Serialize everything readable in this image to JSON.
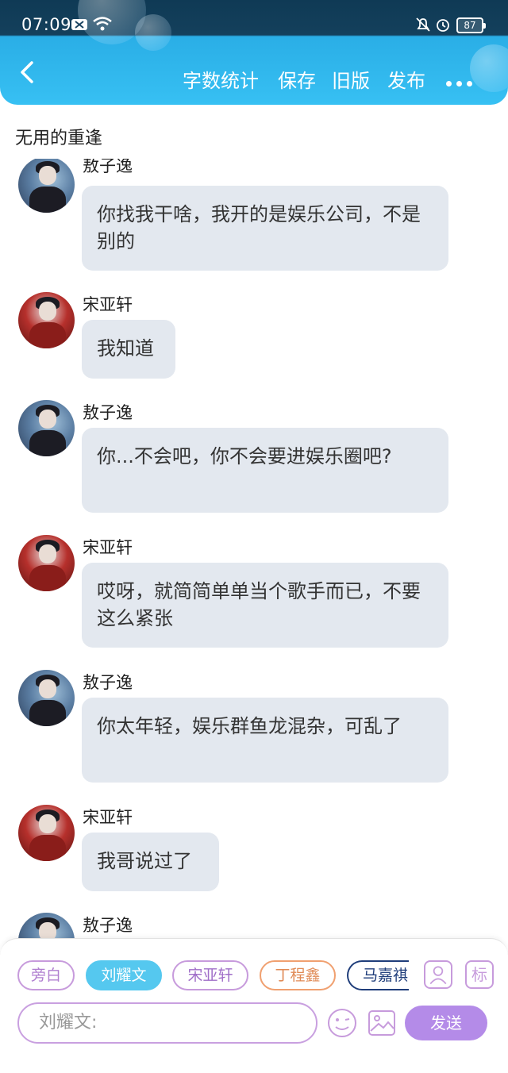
{
  "status": {
    "time": "07:09",
    "battery": "87"
  },
  "toolbar": {
    "word_count": "字数统计",
    "save": "保存",
    "old_version": "旧版",
    "publish": "发布"
  },
  "document": {
    "title": "无用的重逢"
  },
  "messages": [
    {
      "speaker": "敖子逸",
      "text": "你找我干啥，我开的是娱乐公司，不是别的",
      "avatar": "blue"
    },
    {
      "speaker": "宋亚轩",
      "text": "我知道",
      "avatar": "red"
    },
    {
      "speaker": "敖子逸",
      "text": "你...不会吧，你不会要进娱乐圈吧?",
      "avatar": "blue"
    },
    {
      "speaker": "宋亚轩",
      "text": "哎呀，就简简单单当个歌手而已，不要这么紧张",
      "avatar": "red"
    },
    {
      "speaker": "敖子逸",
      "text": "你太年轻，娱乐群鱼龙混杂，可乱了",
      "avatar": "blue"
    },
    {
      "speaker": "宋亚轩",
      "text": "我哥说过了",
      "avatar": "red"
    },
    {
      "speaker": "敖子逸",
      "text": "",
      "avatar": "blue"
    }
  ],
  "characters": [
    {
      "label": "旁白",
      "selected": false
    },
    {
      "label": "刘耀文",
      "selected": true
    },
    {
      "label": "宋亚轩",
      "selected": false
    },
    {
      "label": "丁程鑫",
      "selected": false
    },
    {
      "label": "马嘉祺",
      "selected": false
    }
  ],
  "mark_label": "标",
  "composer": {
    "placeholder": "刘耀文:",
    "send": "发送"
  },
  "colors": {
    "header": "#37c0f3",
    "bubble": "#e3e8ef",
    "accent_purple": "#b48be8",
    "chip_selected": "#55c8ef",
    "chip_orange": "#f0a070",
    "chip_navy": "#1f3d7a"
  }
}
